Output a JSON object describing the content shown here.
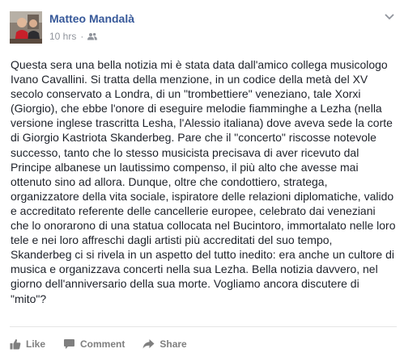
{
  "post": {
    "author": "Matteo Mandalà",
    "time": "10 hrs",
    "separator": "·",
    "privacy_icon": "friends-icon",
    "lines": [
      "Questa sera una bella notizia mi è stata data dall'amico collega musicologo",
      "Ivano Cavallini. Si tratta della menzione, in un codice della metà del XV",
      "secolo conservato a Londra, di un \"trombettiere\" veneziano, tale Xorxi",
      "(Giorgio), che ebbe l'onore di eseguire melodie fiamminghe a Lezha (nella",
      "versione inglese trascritta Lesha, l'Alessio italiana) dove aveva sede la corte",
      "di Giorgio Kastriota Skanderbeg. Pare che il \"concerto\" riscosse notevole",
      "successo, tanto che lo stesso musicista precisava di aver ricevuto dal",
      "Principe albanese un lautissimo compenso, il più alto che avesse mai",
      "ottenuto sino ad allora. Dunque, oltre che condottiero, stratega,",
      "organizzatore della vita sociale, ispiratore delle relazioni diplomatiche, valido",
      "e accreditato referente delle cancellerie europee, celebrato dai veneziani",
      "che lo onorarono di una statua collocata nel Bucintoro, immortalato nelle loro",
      "tele e nei loro affreschi dagli artisti più accreditati del suo tempo,",
      "Skanderbeg ci si rivela in un aspetto del tutto inedito: era anche un cultore di",
      "musica e organizzava concerti nella sua Lezha. Bella notizia davvero, nel",
      "giorno dell'anniversario della sua morte. Vogliamo ancora discutere di",
      "\"mito\"?"
    ]
  },
  "actions": {
    "like": "Like",
    "comment": "Comment",
    "share": "Share"
  },
  "colors": {
    "author": "#365899",
    "meta": "#90949c",
    "text": "#1d2129",
    "actions": "#7f7f7f"
  }
}
